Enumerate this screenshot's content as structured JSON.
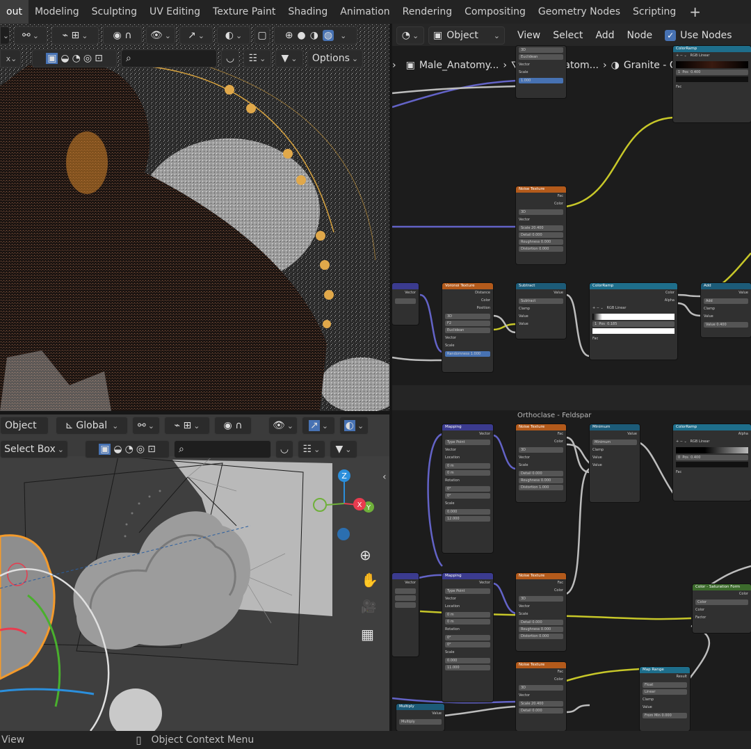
{
  "tabs": [
    "out",
    "Modeling",
    "Sculpting",
    "UV Editing",
    "Texture Paint",
    "Shading",
    "Animation",
    "Rendering",
    "Compositing",
    "Geometry Nodes",
    "Scripting"
  ],
  "top_left_header": {
    "options_label": "Options"
  },
  "node_editor": {
    "object_mode": "Object",
    "menus": [
      "View",
      "Select",
      "Add",
      "Node"
    ],
    "use_nodes_label": "Use Nodes",
    "breadcrumb": [
      "Male_Anatomy...",
      "Male_Anatom...",
      "Granite - Gre..."
    ],
    "frame_title": "Orthoclase - Feldspar",
    "nodes": {
      "noise_texture": "Noise Texture",
      "voronoi_texture": "Voronoi Texture",
      "subtract": "Subtract",
      "color_ramp": "ColorRamp",
      "add": "Add",
      "mapping": "Mapping",
      "minimum": "Minimum",
      "multiply": "Multiply",
      "color_mix": "Color - Saturation Form",
      "map_range": "Map Range",
      "fac": "Fac",
      "color": "Color",
      "vector": "Vector",
      "value": "Value",
      "alpha": "Alpha",
      "distance": "Distance",
      "position": "Position",
      "result": "Result",
      "scale": "Scale",
      "detail": "Detail",
      "roughness": "Roughness",
      "distortion": "Distortion",
      "randomness": "Randomness",
      "clamp": "Clamp",
      "dim_3d": "3D",
      "f2": "F2",
      "euclidean": "Euclidean",
      "rgb": "RGB",
      "linear": "Linear",
      "type": "Type",
      "point": "Point",
      "location": "Location",
      "rotation": "Rotation",
      "factor": "Factor",
      "float": "Float",
      "from_min": "From Min",
      "pos": "Pos",
      "one": "1",
      "zero": "0",
      "v_1000": "1.000",
      "v_0000": "0.000",
      "v_0185": "0.185",
      "v_0400": "0.400",
      "v_0400b": "0.400",
      "v_20400": "20.400",
      "v_0m": "0 m",
      "v_0deg": "0°",
      "v_12000": "12.000",
      "v_11000": "11.000",
      "v_0500": "0.500"
    }
  },
  "viewport_bottom": {
    "mode": "Object",
    "orientation": "Global",
    "select_box": "Select Box",
    "gizmo_z": "Z",
    "gizmo_y": "Y",
    "gizmo_x": "X"
  },
  "status_bar": {
    "left": "View",
    "context_menu": "Object Context Menu"
  },
  "colors": {
    "accent": "#4772b3",
    "selection": "#f39a2b",
    "gizmo_x": "#e83c4f",
    "gizmo_y": "#6fb03a",
    "gizmo_z": "#2b8fdc"
  }
}
